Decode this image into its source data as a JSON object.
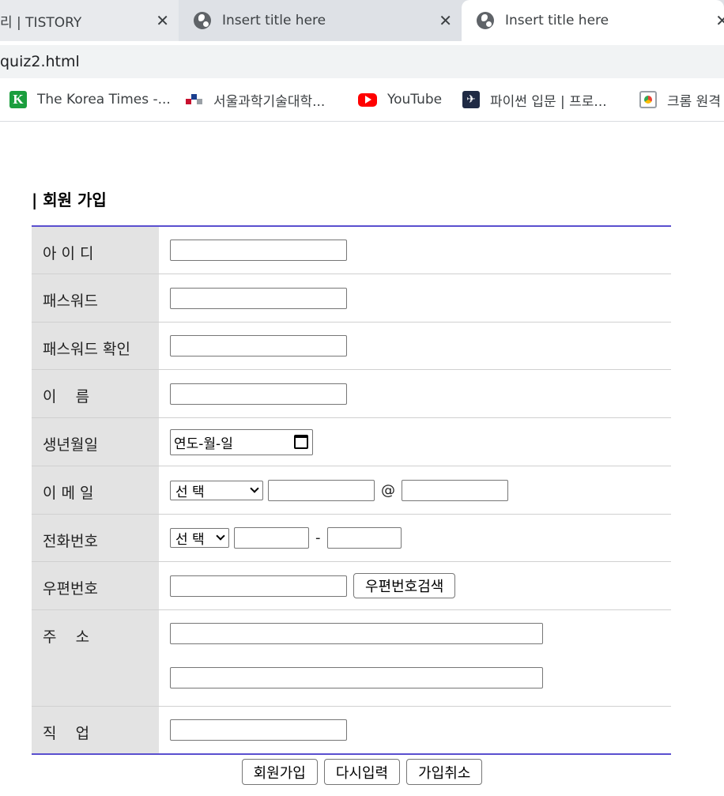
{
  "browser": {
    "tabs": [
      {
        "title": "리 | TISTORY",
        "close": "✕"
      },
      {
        "title": "Insert title here",
        "close": "✕"
      },
      {
        "title": "Insert title here",
        "close": "✕"
      }
    ],
    "address": "quiz2.html",
    "bookmarks": [
      {
        "label": "The Korea Times -...",
        "icon": "korea-times-icon"
      },
      {
        "label": "서울과학기술대학...",
        "icon": "seoultech-icon"
      },
      {
        "label": "YouTube",
        "icon": "youtube-icon"
      },
      {
        "label": "파이썬 입문 | 프로...",
        "icon": "python-icon"
      },
      {
        "label": "크롬 원격",
        "icon": "chrome-remote-icon"
      }
    ]
  },
  "form": {
    "title": "| 회원 가입",
    "labels": {
      "id": "아 이 디",
      "password": "패스워드",
      "password_confirm": "패스워드 확인",
      "name": "이    름",
      "birth": "생년월일",
      "email": "이 메 일",
      "phone": "전화번호",
      "zip": "우편번호",
      "address": "주    소",
      "job": "직    업"
    },
    "birth_placeholder": "연도-월-일",
    "email_select": "선 택",
    "email_at": "@",
    "phone_select": "선 택",
    "phone_dash": "-",
    "zip_button": "우편번호검색",
    "buttons": {
      "submit": "회원가입",
      "reset": "다시입력",
      "cancel": "가입취소"
    }
  },
  "colors": {
    "accent_line": "#5a4fcf",
    "label_bg": "#e3e3e3"
  }
}
